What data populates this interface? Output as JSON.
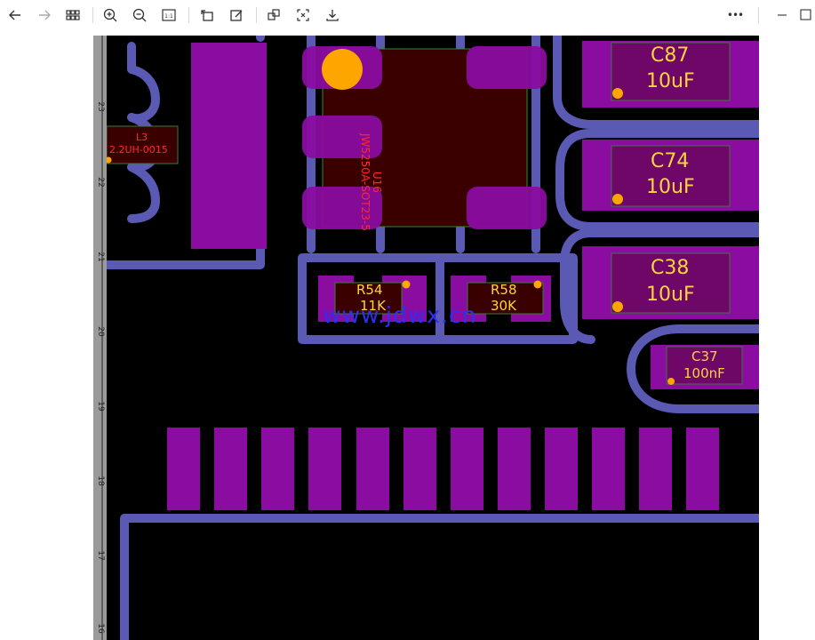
{
  "toolbar": {
    "buttons": [
      {
        "name": "back-arrow-icon"
      },
      {
        "name": "forward-arrow-icon"
      },
      {
        "name": "grid-view-icon"
      },
      {
        "name": "zoom-in-icon"
      },
      {
        "name": "zoom-out-icon"
      },
      {
        "name": "actual-size-icon",
        "glyph": "1:1"
      },
      {
        "name": "rotate-icon"
      },
      {
        "name": "edit-icon"
      },
      {
        "name": "copy-icon"
      },
      {
        "name": "fit-screen-icon"
      },
      {
        "name": "save-icon"
      }
    ],
    "more": "•••",
    "minimize": "—",
    "maximize": "☐"
  },
  "ruler": {
    "ticks": [
      "23",
      "22",
      "21",
      "20",
      "19",
      "18",
      "17",
      "16"
    ]
  },
  "pcb": {
    "colors": {
      "background": "#000000",
      "pad": "#8a0ca0",
      "trace": "#5a5ab4",
      "silkscreen": "#ffd43a",
      "refdes": "#ff2a2a",
      "via": "#ffa500"
    },
    "inductor": {
      "ref": "L3",
      "value": "2.2UH-0015"
    },
    "ic": {
      "ref": "U16",
      "value": "JW5250A-SOT23-5"
    },
    "resistors": [
      {
        "ref": "R54",
        "value": "11K"
      },
      {
        "ref": "R58",
        "value": "30K"
      }
    ],
    "capacitors": [
      {
        "ref": "C87",
        "value": "10uF"
      },
      {
        "ref": "C74",
        "value": "10uF"
      },
      {
        "ref": "C38",
        "value": "10uF"
      },
      {
        "ref": "C37",
        "value": "100nF"
      }
    ],
    "watermark": "www.jdwx.cn"
  }
}
